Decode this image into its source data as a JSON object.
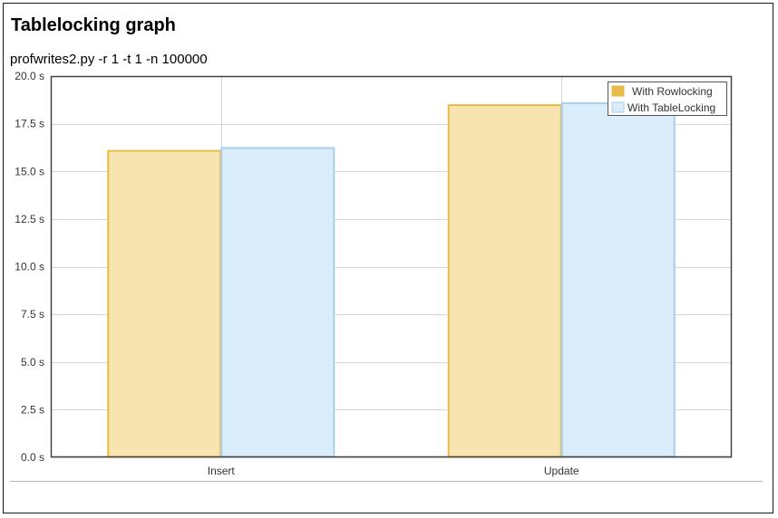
{
  "page": {
    "title": "Tablelocking graph",
    "subtitle": "profwrites2.py -r 1 -t 1 -n 100000"
  },
  "chart_data": {
    "type": "bar",
    "title": "",
    "xlabel": "",
    "ylabel": "",
    "categories": [
      "Insert",
      "Update"
    ],
    "series": [
      {
        "name": "With Rowlocking",
        "values": [
          16.1,
          18.5
        ],
        "color": "#e8bb48",
        "fill": "#f8e4b0"
      },
      {
        "name": "With TableLocking",
        "values": [
          16.25,
          18.6
        ],
        "color": "#a8d0ec",
        "fill": "#dbecfa"
      }
    ],
    "ylim": [
      0,
      20
    ],
    "yticks": [
      0,
      2.5,
      5,
      7.5,
      10,
      12.5,
      15,
      17.5,
      20
    ],
    "ytick_labels": [
      "0.0 s",
      "2.5 s",
      "5.0 s",
      "7.5 s",
      "10.0 s",
      "12.5 s",
      "15.0 s",
      "17.5 s",
      "20.0 s"
    ],
    "grid": true,
    "legend_position": "top-right"
  }
}
